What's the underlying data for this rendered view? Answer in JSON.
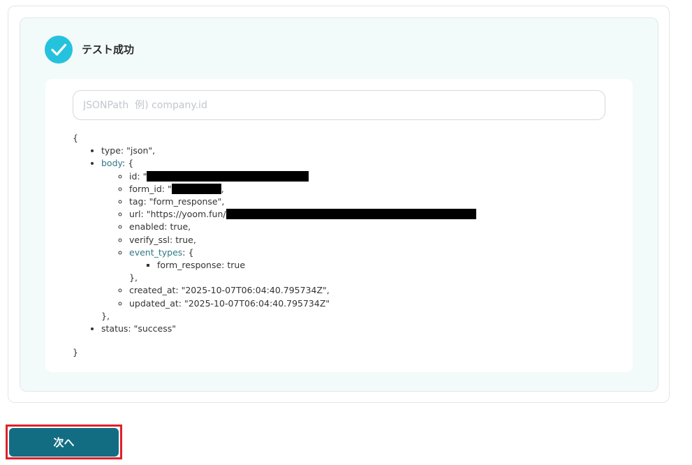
{
  "result": {
    "status_title": "テスト成功",
    "status_icon": "check-icon",
    "accent_color": "#25c2dd"
  },
  "jsonpath": {
    "placeholder": "JSONPath  例) company.id",
    "value": ""
  },
  "json": {
    "open_brace": "{",
    "close_brace": "}",
    "type_line": "type: \"json\",",
    "body_key": "body",
    "body_open": ": {",
    "id_prefix": "id: \"",
    "form_id_prefix": "form_id: \"",
    "form_id_suffix": ",",
    "tag_line": "tag: \"form_response\",",
    "url_prefix": "url: \"https://yoom.fun/",
    "enabled_line": "enabled: true,",
    "verify_ssl_line": "verify_ssl: true,",
    "event_types_key": "event_types",
    "event_types_open": ": {",
    "form_response_line": "form_response: true",
    "event_types_close": "},",
    "created_at_line": "created_at: \"2025-10-07T06:04:40.795734Z\",",
    "updated_at_line": "updated_at: \"2025-10-07T06:04:40.795734Z\"",
    "body_close": "},",
    "status_line": "status: \"success\""
  },
  "actions": {
    "next_label": "次へ",
    "highlight_color": "#e0202a"
  }
}
